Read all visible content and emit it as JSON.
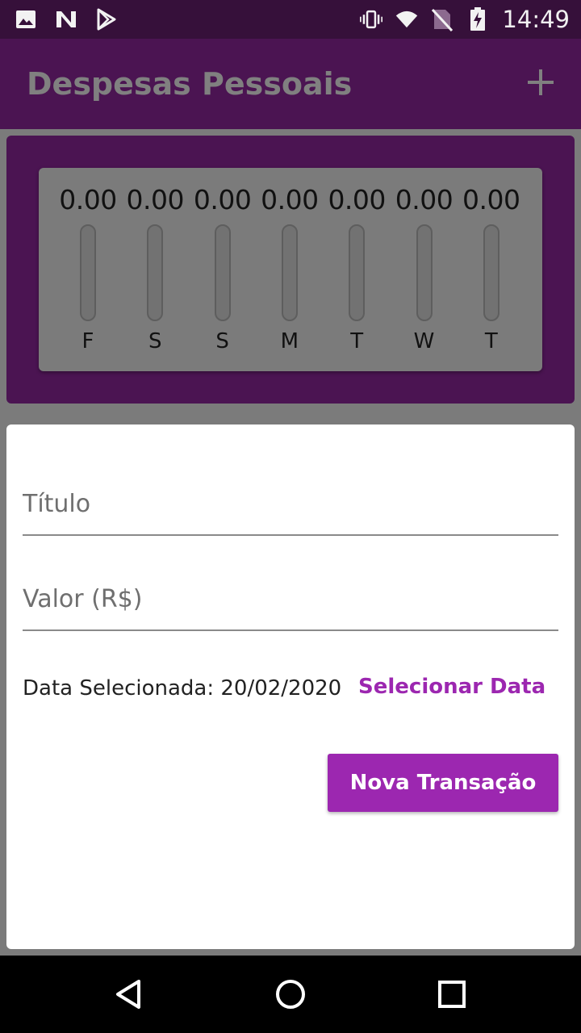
{
  "status_bar": {
    "time": "14:49",
    "icons": [
      "image-icon",
      "n-notification-icon",
      "play-store-icon",
      "vibrate-icon",
      "wifi-icon",
      "no-sim-icon",
      "battery-charging-icon"
    ]
  },
  "app_bar": {
    "title": "Despesas Pessoais",
    "add_icon": "plus-icon"
  },
  "chart_data": {
    "type": "bar",
    "categories": [
      "F",
      "S",
      "S",
      "M",
      "T",
      "W",
      "T"
    ],
    "values": [
      0.0,
      0.0,
      0.0,
      0.0,
      0.0,
      0.0,
      0.0
    ],
    "value_labels": [
      "0.00",
      "0.00",
      "0.00",
      "0.00",
      "0.00",
      "0.00",
      "0.00"
    ],
    "title": "",
    "xlabel": "",
    "ylabel": "",
    "grid": false
  },
  "form": {
    "title_placeholder": "Título",
    "value_placeholder": "Valor (R$)",
    "date_label": "Data Selecionada: 20/02/2020",
    "select_date_label": "Selecionar Data",
    "submit_label": "Nova Transação"
  },
  "colors": {
    "primary": "#9c27b0",
    "app_bar_dimmed": "#4b1452",
    "status_bar": "#36103a"
  },
  "nav_bar": {
    "icons": [
      "back-icon",
      "home-icon",
      "recents-icon"
    ]
  }
}
